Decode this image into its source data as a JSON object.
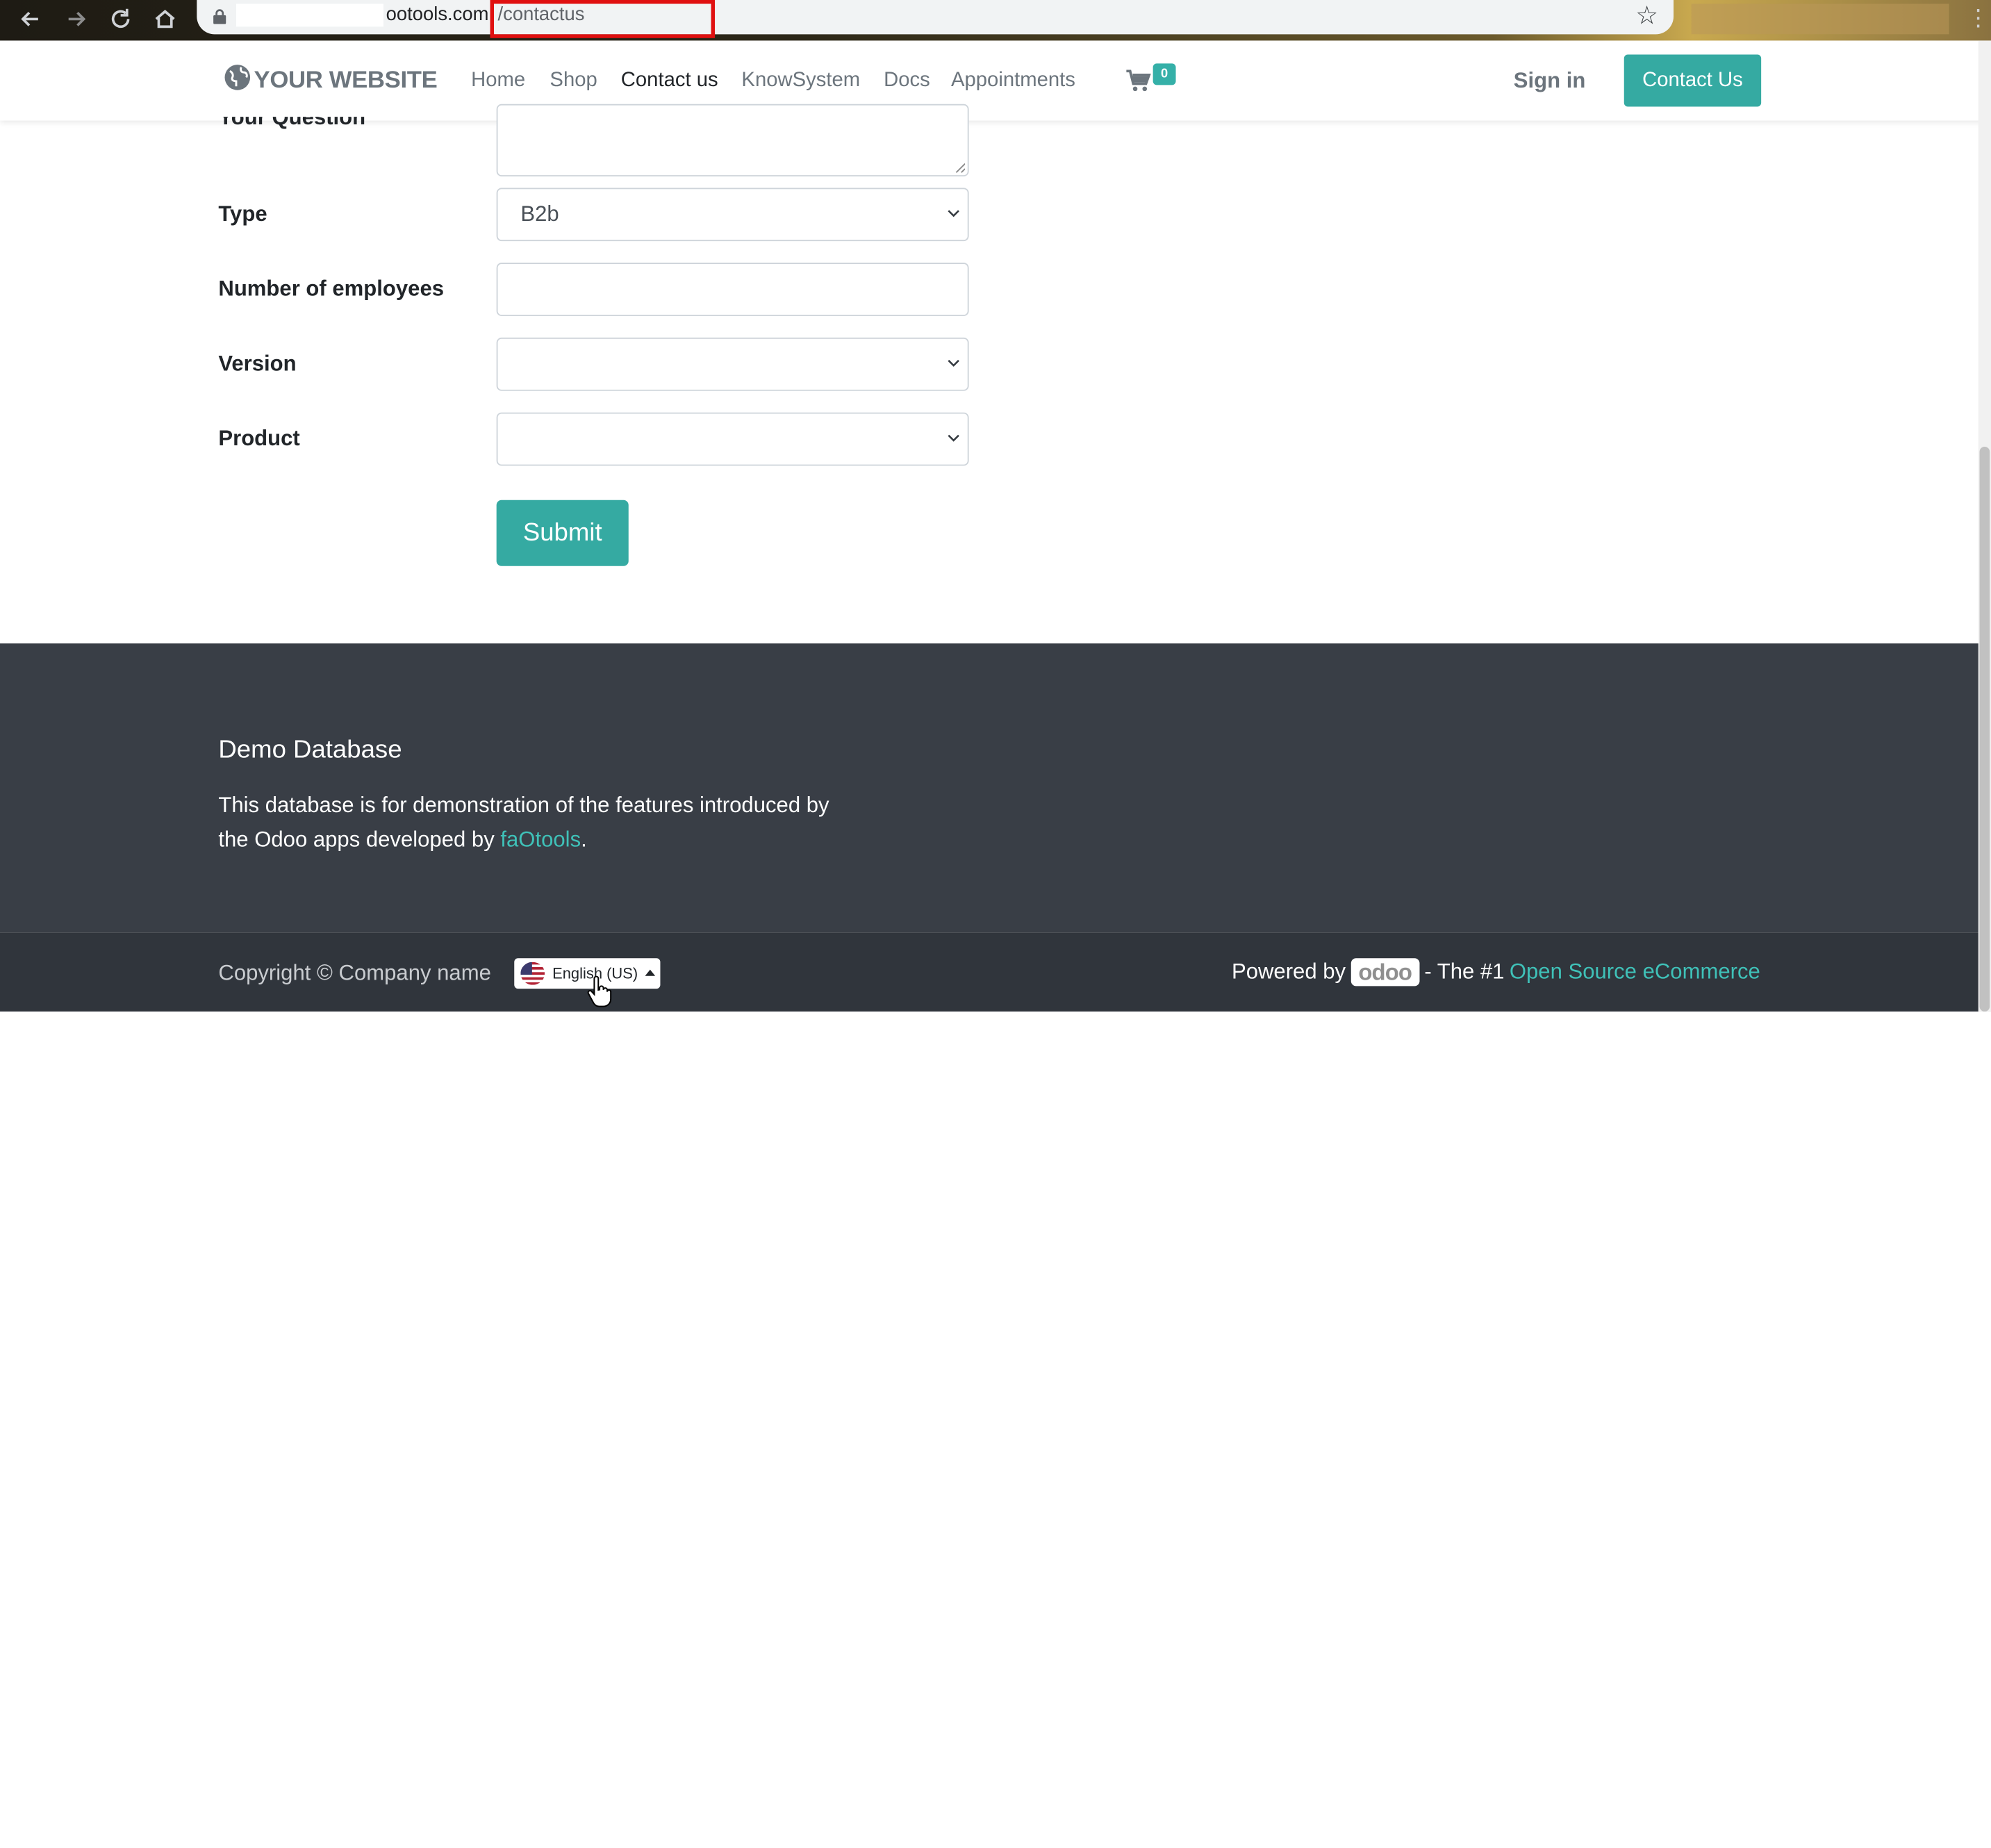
{
  "browser": {
    "url_domain": "ootools.com",
    "url_path": "/contactus",
    "back_icon": "arrow-left",
    "forward_icon": "arrow-right",
    "reload_icon": "reload",
    "home_icon": "home",
    "star_icon": "star",
    "menu_icon": "kebab"
  },
  "navbar": {
    "logo_text": "YOUR WEBSITE",
    "links": [
      "Home",
      "Shop",
      "Contact us",
      "KnowSystem",
      "Docs",
      "Appointments"
    ],
    "active_link": "Contact us",
    "cart_count": "0",
    "sign_in": "Sign in",
    "contact_button": "Contact Us"
  },
  "form": {
    "question_label": "Your Question",
    "type_label": "Type",
    "type_value": "B2b",
    "employees_label": "Number of employees",
    "employees_value": "",
    "version_label": "Version",
    "version_value": "",
    "product_label": "Product",
    "product_value": "",
    "submit_label": "Submit"
  },
  "footer": {
    "title": "Demo Database",
    "text_part1": "This database is for demonstration of the features introduced by the Odoo apps developed by ",
    "text_link": "faOtools",
    "text_end": ".",
    "copyright": "Copyright © Company name",
    "language": "English (US)",
    "powered_by": "Powered by",
    "odoo_logo": "odoo",
    "the_number1": "- The #1",
    "ecommerce_link": "Open Source eCommerce"
  },
  "colors": {
    "accent": "#35aaa2",
    "footer_bg": "#393e46",
    "copyright_bg": "#30353c",
    "link": "#3fc1b8",
    "highlight_box": "#e01010"
  }
}
